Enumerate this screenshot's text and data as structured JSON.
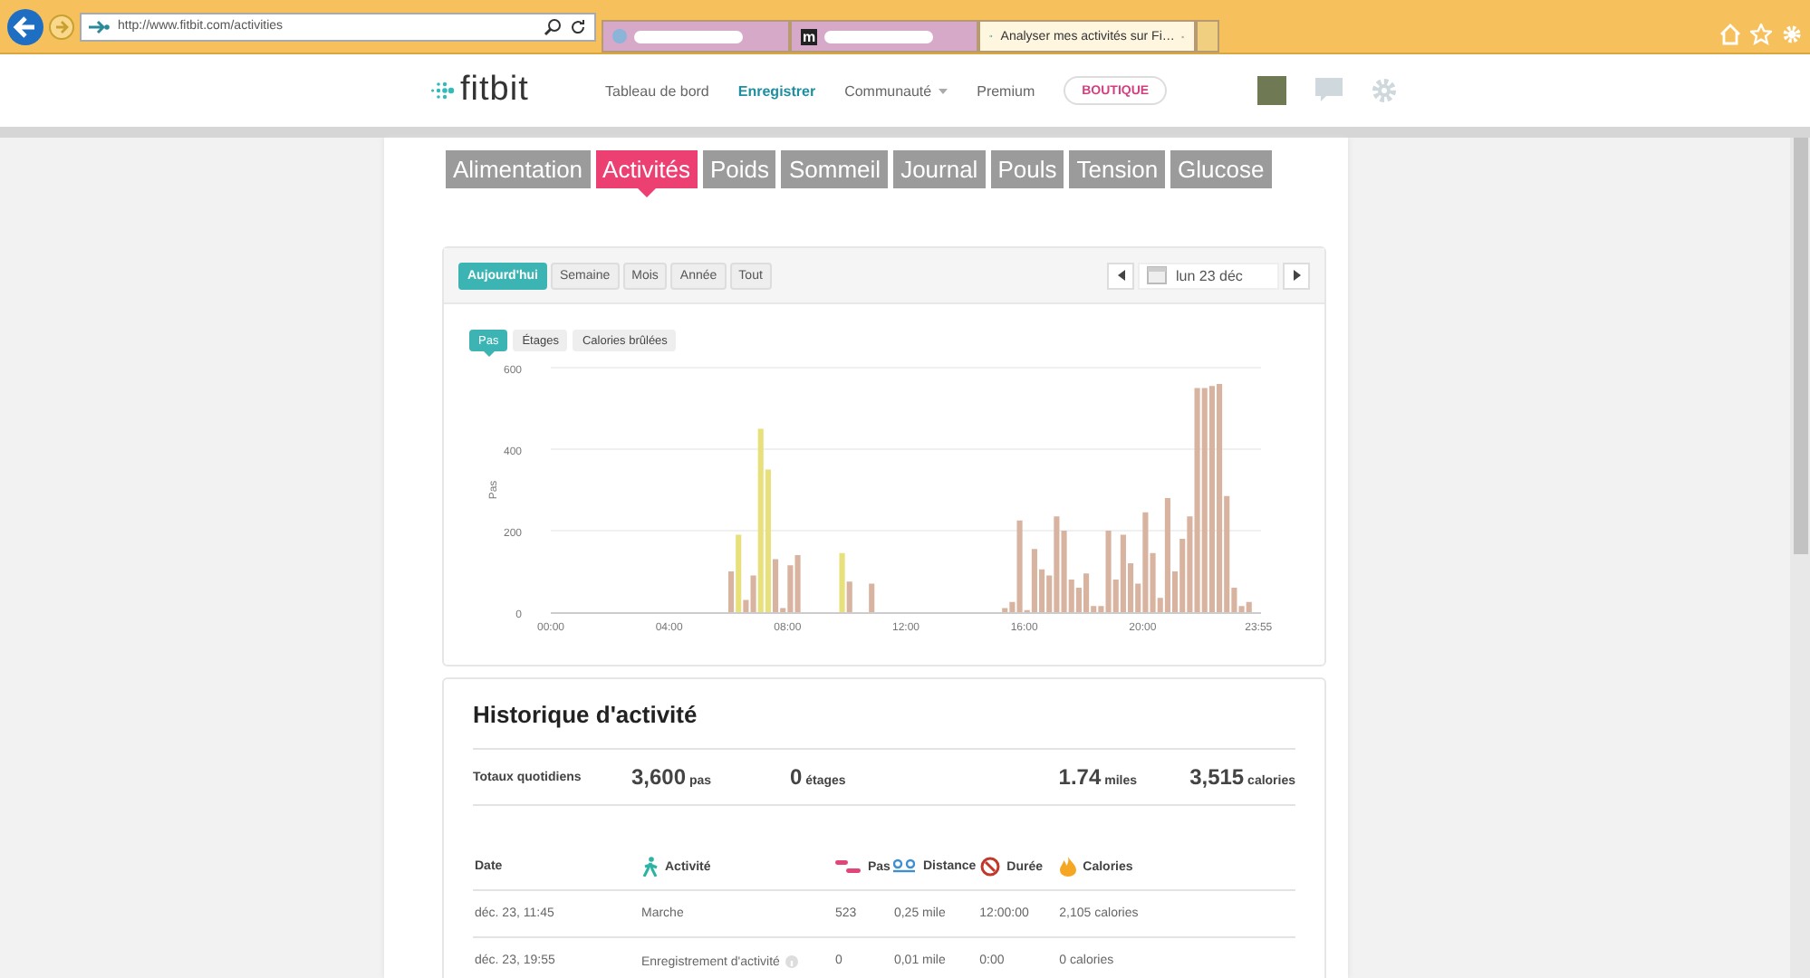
{
  "browser": {
    "url": "http://www.fitbit.com/activities",
    "tabs": [
      {
        "selected": false,
        "kind": "blurred"
      },
      {
        "selected": false,
        "kind": "blurred",
        "glyph": "m"
      },
      {
        "selected": true,
        "kind": "page",
        "title": "Analyser mes activités sur Fi…"
      }
    ]
  },
  "header": {
    "logo": "fitbit",
    "nav": [
      {
        "label": "Tableau de bord",
        "selected": false,
        "dropdown": false
      },
      {
        "label": "Enregistrer",
        "selected": true,
        "dropdown": false
      },
      {
        "label": "Communauté",
        "selected": false,
        "dropdown": true
      },
      {
        "label": "Premium",
        "selected": false,
        "dropdown": false
      }
    ],
    "shop_button": "BOUTIQUE"
  },
  "category_tabs": [
    {
      "label": "Alimentation",
      "selected": false
    },
    {
      "label": "Activités",
      "selected": true
    },
    {
      "label": "Poids",
      "selected": false
    },
    {
      "label": "Sommeil",
      "selected": false
    },
    {
      "label": "Journal",
      "selected": false
    },
    {
      "label": "Pouls",
      "selected": false
    },
    {
      "label": "Tension",
      "selected": false
    },
    {
      "label": "Glucose",
      "selected": false
    }
  ],
  "period_buttons": [
    {
      "label": "Aujourd'hui",
      "selected": true
    },
    {
      "label": "Semaine",
      "selected": false
    },
    {
      "label": "Mois",
      "selected": false
    },
    {
      "label": "Année",
      "selected": false
    },
    {
      "label": "Tout",
      "selected": false
    }
  ],
  "date_picker": {
    "value": "lun 23 déc"
  },
  "metric_tabs": [
    {
      "label": "Pas",
      "selected": true
    },
    {
      "label": "Étages",
      "selected": false
    },
    {
      "label": "Calories brûlées",
      "selected": false
    }
  ],
  "chart_data": {
    "type": "bar",
    "ylabel": "Pas",
    "stacked": true,
    "xlim": [
      0,
      24
    ],
    "ylim": [
      0,
      600
    ],
    "yticks": [
      0,
      200,
      400,
      600
    ],
    "xticks": [
      {
        "value": 0,
        "label": "00:00"
      },
      {
        "value": 4,
        "label": "04:00"
      },
      {
        "value": 8,
        "label": "08:00"
      },
      {
        "value": 12,
        "label": "12:00"
      },
      {
        "value": 16,
        "label": "16:00"
      },
      {
        "value": 20,
        "label": "20:00"
      },
      {
        "value": 23.917,
        "label": "23:55"
      }
    ],
    "x": [
      0,
      0.25,
      0.5,
      0.75,
      1,
      1.25,
      1.5,
      1.75,
      2,
      2.25,
      2.5,
      2.75,
      3,
      3.25,
      3.5,
      3.75,
      4,
      4.25,
      4.5,
      4.75,
      5,
      5.25,
      5.5,
      5.75,
      6,
      6.25,
      6.5,
      6.75,
      7,
      7.25,
      7.5,
      7.75,
      8,
      8.25,
      8.5,
      8.75,
      9,
      9.25,
      9.5,
      9.75,
      10,
      10.25,
      10.5,
      10.75,
      11,
      11.25,
      11.5,
      11.75,
      12,
      12.25,
      12.5,
      12.75,
      13,
      13.25,
      13.5,
      13.75,
      14,
      14.25,
      14.5,
      14.75,
      15,
      15.25,
      15.5,
      15.75,
      16,
      16.25,
      16.5,
      16.75,
      17,
      17.25,
      17.5,
      17.75,
      18,
      18.25,
      18.5,
      18.75,
      19,
      19.25,
      19.5,
      19.75,
      20,
      20.25,
      20.5,
      20.75,
      21,
      21.25,
      21.5,
      21.75,
      22,
      22.25,
      22.5,
      22.75,
      23,
      23.25,
      23.5,
      23.75
    ],
    "series": [
      {
        "color": "#e8e07a",
        "values": [
          0,
          0,
          0,
          0,
          0,
          0,
          0,
          0,
          0,
          0,
          0,
          0,
          0,
          0,
          0,
          0,
          0,
          0,
          0,
          0,
          0,
          0,
          0,
          0,
          0,
          190,
          0,
          0,
          450,
          350,
          0,
          0,
          0,
          0,
          0,
          0,
          0,
          0,
          0,
          145,
          0,
          0,
          0,
          0,
          0,
          0,
          0,
          0,
          0,
          0,
          0,
          0,
          0,
          0,
          0,
          0,
          0,
          0,
          0,
          0,
          0,
          0,
          0,
          0,
          0,
          0,
          0,
          0,
          0,
          0,
          0,
          0,
          0,
          0,
          0,
          0,
          0,
          0,
          0,
          0,
          0,
          0,
          0,
          0,
          0,
          0,
          0,
          0,
          0,
          0,
          0,
          0,
          0,
          0,
          0,
          0
        ]
      },
      {
        "color": "#d8b4a0",
        "values": [
          0,
          0,
          0,
          0,
          0,
          0,
          0,
          0,
          0,
          0,
          0,
          0,
          0,
          0,
          0,
          0,
          0,
          0,
          0,
          0,
          0,
          0,
          0,
          0,
          100,
          0,
          30,
          90,
          0,
          0,
          130,
          10,
          115,
          140,
          0,
          0,
          0,
          0,
          0,
          0,
          75,
          0,
          0,
          70,
          0,
          0,
          0,
          0,
          0,
          0,
          0,
          0,
          0,
          0,
          0,
          0,
          0,
          0,
          0,
          0,
          0,
          10,
          25,
          225,
          5,
          155,
          105,
          90,
          235,
          200,
          80,
          60,
          95,
          15,
          15,
          200,
          80,
          190,
          120,
          70,
          245,
          145,
          35,
          280,
          100,
          180,
          235,
          550,
          550,
          555,
          560,
          285,
          60,
          15,
          25,
          0
        ]
      }
    ]
  },
  "history": {
    "title": "Historique d'activité",
    "totals_label": "Totaux quotidiens",
    "totals": [
      {
        "value": "3,600",
        "unit": "pas"
      },
      {
        "value": "0",
        "unit": "étages"
      },
      {
        "value": "1.74",
        "unit": "miles"
      },
      {
        "value": "3,515",
        "unit": "calories"
      }
    ],
    "columns": [
      {
        "label": "Date",
        "kind": "plain"
      },
      {
        "label": "Activité",
        "kind": "activity"
      },
      {
        "label": "Pas",
        "kind": "steps"
      },
      {
        "label": "Distance",
        "kind": "distance"
      },
      {
        "label": "Durée",
        "kind": "duration"
      },
      {
        "label": "Calories",
        "kind": "calories"
      }
    ],
    "rows": [
      {
        "cells": [
          "déc. 23, 11:45",
          "Marche",
          "523",
          "0,25 mile",
          "12:00:00",
          "2,105 calories"
        ],
        "info": false
      },
      {
        "cells": [
          "déc. 23, 19:55",
          "Enregistrement d'activité",
          "0",
          "0,01 mile",
          "0:00",
          "0 calories"
        ],
        "info": true
      }
    ]
  }
}
